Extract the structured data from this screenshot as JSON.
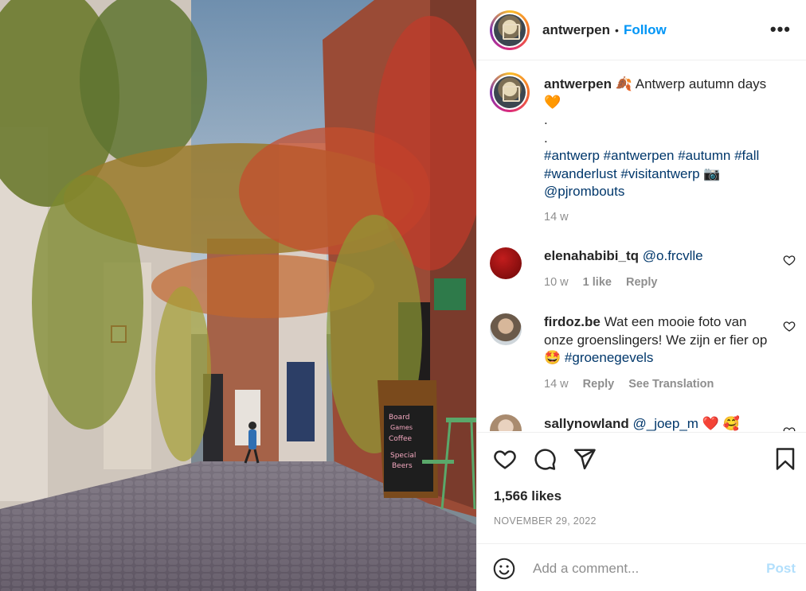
{
  "post": {
    "username": "antwerpen",
    "follow_label": "Follow",
    "separator": "•",
    "more_label": "•••"
  },
  "caption": {
    "username": "antwerpen",
    "emoji_leaf": "🍂",
    "text": "Antwerp autumn days",
    "emoji_heart": "🧡",
    "dots": [
      ".",
      "."
    ],
    "hashtags_line1": "#antwerp #antwerpen #autumn #fall",
    "hashtags_line2": "#wanderlust #visitantwerp",
    "emoji_camera": "📷",
    "mention": "@pjrombouts",
    "time": "14 w"
  },
  "comments": [
    {
      "username": "elenahabibi_tq",
      "text": "@o.frcvlle",
      "time": "10 w",
      "likes": "1 like",
      "reply": "Reply",
      "avatar_color": "#8b0d0d"
    },
    {
      "username": "firdoz.be",
      "text_before": "Wat een mooie foto van onze groenslingers! We zijn er fier op",
      "emoji": "🤩",
      "hashtag": "#groenegevels",
      "time": "14 w",
      "reply": "Reply",
      "translation": "See Translation",
      "avatar_color": "#6b5a4a"
    },
    {
      "username": "sallynowland",
      "text": "@_joep_m",
      "emojis": "❤️ 🥰",
      "avatar_color": "#c9b39a"
    }
  ],
  "stats": {
    "likes": "1,566 likes",
    "date": "NOVEMBER 29, 2022"
  },
  "compose": {
    "placeholder": "Add a comment...",
    "post_label": "Post"
  },
  "icons": {
    "like": "heart-icon",
    "comment": "comment-icon",
    "share": "share-icon",
    "save": "bookmark-icon",
    "emoji": "emoji-icon",
    "more": "more-icon"
  },
  "colors": {
    "accent": "#0095f6",
    "link": "#00376b",
    "muted": "#8e8e8e",
    "post_disabled": "#b2dffc"
  }
}
